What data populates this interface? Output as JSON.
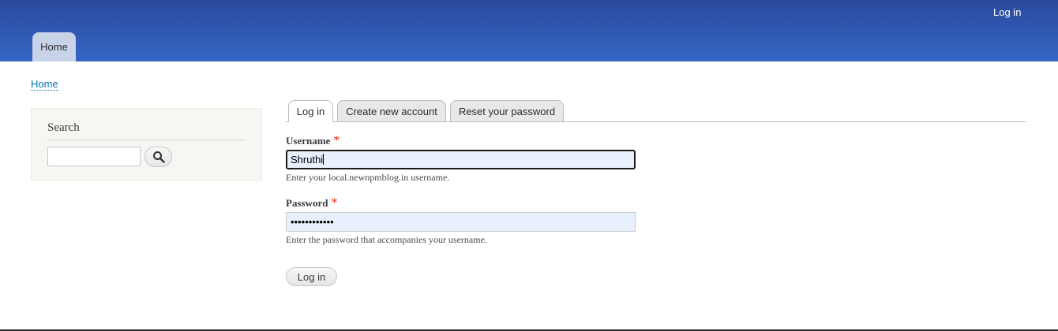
{
  "header": {
    "login_link": "Log in",
    "primary_tab": "Home",
    "gradient_top": "#2a4a9c",
    "gradient_bottom": "#3566c4"
  },
  "breadcrumb": {
    "home": "Home"
  },
  "sidebar": {
    "title": "Search",
    "search_value": "",
    "search_icon": "magnifier-icon"
  },
  "tabs": [
    {
      "label": "Log in",
      "active": true
    },
    {
      "label": "Create new account",
      "active": false
    },
    {
      "label": "Reset your password",
      "active": false
    }
  ],
  "form": {
    "username": {
      "label": "Username",
      "required": "*",
      "value": "Shruthi",
      "description": "Enter your local.newnpmblog.in username."
    },
    "password": {
      "label": "Password",
      "required": "*",
      "value": "••••••••••••",
      "description": "Enter the password that accompanies your username."
    },
    "submit_label": "Log in"
  }
}
